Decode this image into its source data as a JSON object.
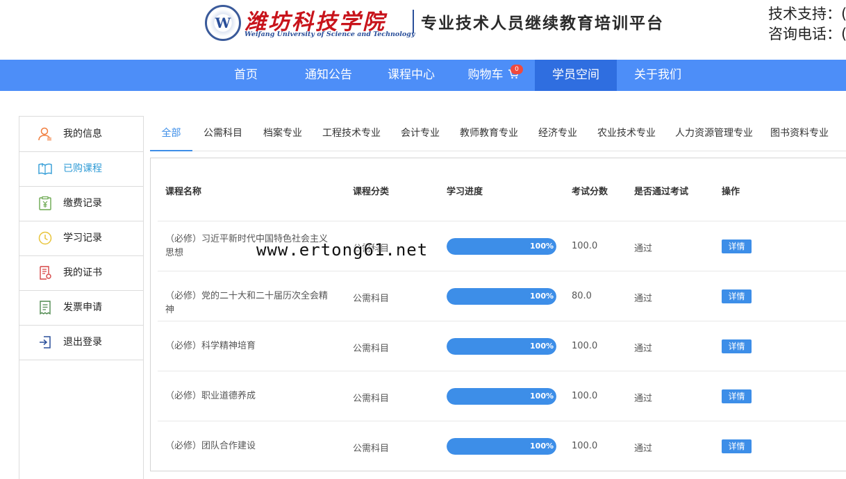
{
  "header": {
    "logo_letter": "W",
    "school_name": "潍坊科技学院",
    "school_name_en": "Weifang University of Science and Technology",
    "platform_name": "专业技术人员继续教育培训平台",
    "tech_support": "技术支持：(",
    "hotline": "咨询电话：("
  },
  "nav": {
    "items": [
      {
        "label": "首页"
      },
      {
        "label": "通知公告"
      },
      {
        "label": "课程中心"
      },
      {
        "label": "购物车"
      },
      {
        "label": "学员空间"
      },
      {
        "label": "关于我们"
      }
    ],
    "cart_count": "0"
  },
  "sidebar": {
    "items": [
      {
        "label": "我的信息",
        "icon": "user-icon",
        "color": "#f07b3a"
      },
      {
        "label": "已购课程",
        "icon": "book-icon",
        "color": "#2f9bd6"
      },
      {
        "label": "缴费记录",
        "icon": "payment-icon",
        "color": "#6aa84f"
      },
      {
        "label": "学习记录",
        "icon": "clock-icon",
        "color": "#e8c43a"
      },
      {
        "label": "我的证书",
        "icon": "certificate-icon",
        "color": "#d64545"
      },
      {
        "label": "发票申请",
        "icon": "invoice-icon",
        "color": "#4f8a4f"
      },
      {
        "label": "退出登录",
        "icon": "logout-icon",
        "color": "#2a4f9a"
      }
    ]
  },
  "tabs": [
    {
      "label": "全部"
    },
    {
      "label": "公需科目"
    },
    {
      "label": "档案专业"
    },
    {
      "label": "工程技术专业"
    },
    {
      "label": "会计专业"
    },
    {
      "label": "教师教育专业"
    },
    {
      "label": "经济专业"
    },
    {
      "label": "农业技术专业"
    },
    {
      "label": "人力资源管理专业"
    },
    {
      "label": "图书资料专业"
    }
  ],
  "table": {
    "headers": {
      "name": "课程名称",
      "category": "课程分类",
      "progress": "学习进度",
      "score": "考试分数",
      "passed": "是否通过考试",
      "action": "操作"
    },
    "rows": [
      {
        "name": "（必修）习近平新时代中国特色社会主义思想",
        "category": "公需科目",
        "progress": 100,
        "progress_label": "100%",
        "score": "100.0",
        "passed": "通过",
        "action": "详情"
      },
      {
        "name": "（必修）党的二十大和二十届历次全会精神",
        "category": "公需科目",
        "progress": 100,
        "progress_label": "100%",
        "score": "80.0",
        "passed": "通过",
        "action": "详情"
      },
      {
        "name": "（必修）科学精神培育",
        "category": "公需科目",
        "progress": 100,
        "progress_label": "100%",
        "score": "100.0",
        "passed": "通过",
        "action": "详情"
      },
      {
        "name": "（必修）职业道德养成",
        "category": "公需科目",
        "progress": 100,
        "progress_label": "100%",
        "score": "100.0",
        "passed": "通过",
        "action": "详情"
      },
      {
        "name": "（必修）团队合作建设",
        "category": "公需科目",
        "progress": 100,
        "progress_label": "100%",
        "score": "100.0",
        "passed": "通过",
        "action": "详情"
      }
    ]
  },
  "watermark": "www.ertong61.net",
  "colors": {
    "nav_bg": "#4d8ef8",
    "nav_active": "#2f6ee0",
    "accent": "#3d8ee8",
    "school_red": "#c8131b"
  }
}
